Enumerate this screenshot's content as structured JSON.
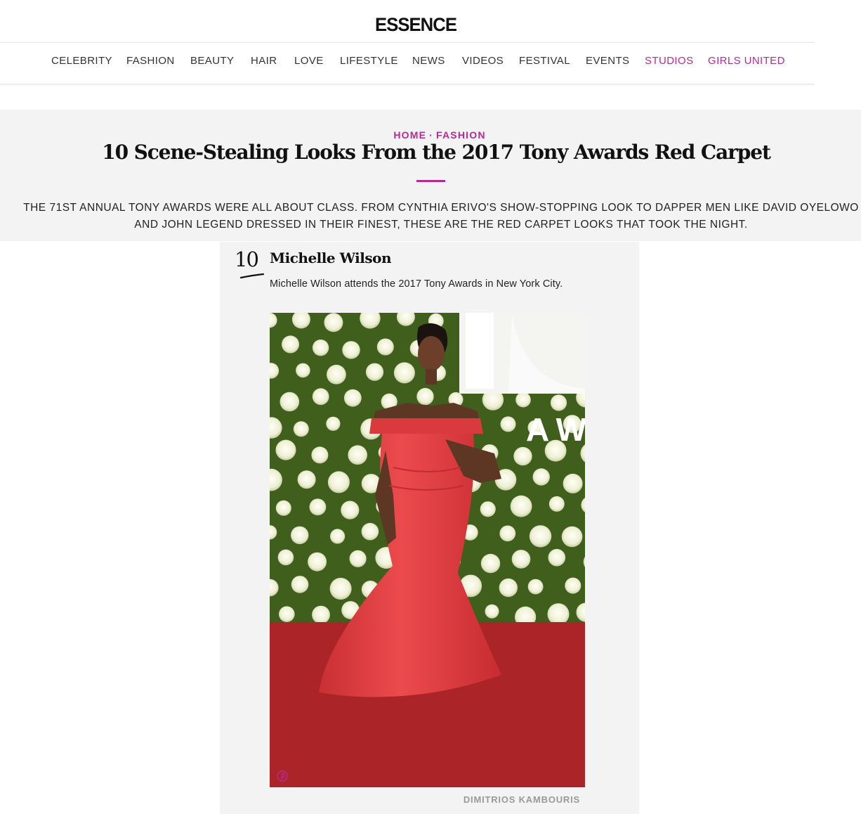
{
  "brand": {
    "logo": "ESSENCE",
    "accent_color": "#b52b93"
  },
  "nav": {
    "items": [
      {
        "label": "CELEBRITY"
      },
      {
        "label": "FASHION"
      },
      {
        "label": "BEAUTY"
      },
      {
        "label": "HAIR"
      },
      {
        "label": "LOVE"
      },
      {
        "label": "LIFESTYLE"
      },
      {
        "label": "NEWS"
      },
      {
        "label": "VIDEOS"
      },
      {
        "label": "FESTIVAL"
      },
      {
        "label": "EVENTS"
      },
      {
        "label": "STUDIOS",
        "accent": true
      },
      {
        "label": "GIRLS UNITED",
        "accent": true
      }
    ]
  },
  "article": {
    "breadcrumb": {
      "home": "HOME",
      "separator": "·",
      "section": "FASHION"
    },
    "title": "10 Scene-Stealing Looks From the 2017 Tony Awards Red Carpet",
    "dek": "THE 71ST ANNUAL TONY AWARDS WERE ALL ABOUT CLASS. FROM CYNTHIA ERIVO'S SHOW-STOPPING LOOK TO DAPPER MEN LIKE DAVID OYELOWO AND JOHN LEGEND DRESSED IN THEIR FINEST, THESE ARE THE RED CARPET LOOKS THAT TOOK THE NIGHT."
  },
  "slide": {
    "number": "10",
    "name": "Michelle Wilson",
    "caption": "Michelle Wilson attends the 2017 Tony Awards in New York City.",
    "photo_backdrop_text": "AW",
    "credit": "DIMITRIOS KAMBOURIS",
    "pin_icon": "pinterest-icon"
  }
}
